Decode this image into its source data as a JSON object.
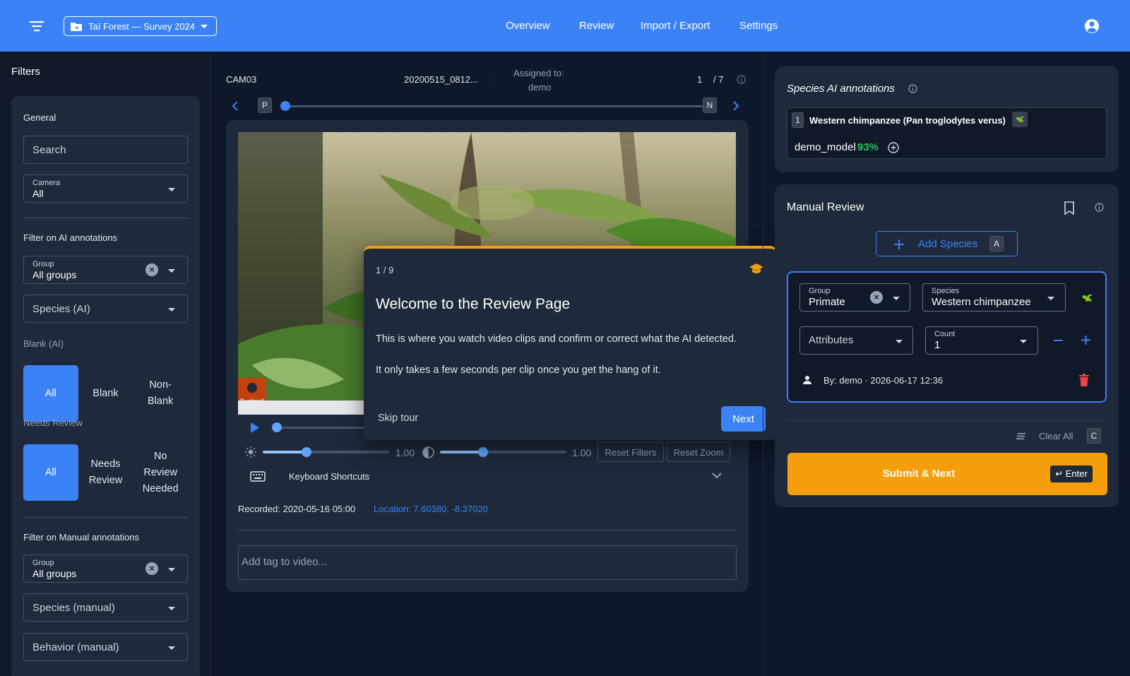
{
  "header": {
    "project": "Taï Forest — Survey 2024",
    "nav": [
      "Overview",
      "Review",
      "Import / Export",
      "Settings"
    ]
  },
  "filters": {
    "title": "Filters",
    "general": "General",
    "search_placeholder": "Search",
    "camera": {
      "label": "Camera",
      "value": "All"
    },
    "ai_section": "Filter on AI annotations",
    "ai_group": {
      "label": "Group",
      "value": "All groups"
    },
    "species_ai": "Species (AI)",
    "blank_label": "Blank (AI)",
    "blank_options": [
      "All",
      "Blank",
      "Non-Blank"
    ],
    "needs_review_label": "Needs Review",
    "review_options": [
      "All",
      "Needs Review",
      "No Review Needed"
    ],
    "manual_section": "Filter on Manual annotations",
    "manual_group": {
      "label": "Group",
      "value": "All groups"
    },
    "species_manual": "Species (manual)",
    "behavior_manual": "Behavior (manual)"
  },
  "clip": {
    "camera": "CAM03",
    "file": "20200515_0812...",
    "sep": "·",
    "assigned_label": "Assigned to:",
    "assigned_user": "demo",
    "index": "1",
    "total": "/ 7",
    "prev_key": "P",
    "next_key": "N",
    "watermark": "Bushnell",
    "brightness": "1.00",
    "contrast": "1.00",
    "reset_filters": "Reset Filters",
    "reset_zoom": "Reset Zoom",
    "shortcuts": "Keyboard Shortcuts",
    "recorded": "Recorded: 2020-05-16 05:00",
    "location": "Location: 7.60380, -8.37020",
    "tag_placeholder": "Add tag to video..."
  },
  "tour": {
    "step": "1 / 9",
    "title": "Welcome to the Review Page",
    "p1": "This is where you watch video clips and confirm or correct what the AI detected.",
    "p2": "It only takes a few seconds per clip once you get the hang of it.",
    "skip": "Skip tour",
    "next": "Next"
  },
  "ai_annotations": {
    "title": "Species AI annotations",
    "rank": "1",
    "species": "Western chimpanzee (Pan troglodytes verus)",
    "model": "demo_model",
    "confidence": "93%"
  },
  "manual_review": {
    "title": "Manual Review",
    "add_species": "Add Species",
    "add_key": "A",
    "group": {
      "label": "Group",
      "value": "Primate"
    },
    "species": {
      "label": "Species",
      "value": "Western chimpanzee"
    },
    "attributes": "Attributes",
    "count": {
      "label": "Count",
      "value": "1"
    },
    "by": "By: demo · 2026-06-17 12:36",
    "clear_all": "Clear All",
    "clear_key": "C",
    "submit": "Submit & Next",
    "submit_key": "↵ Enter"
  },
  "colors": {
    "primary": "#3b82f6",
    "accent": "#f59e0b",
    "success": "#22c55e",
    "danger": "#ef4444"
  }
}
